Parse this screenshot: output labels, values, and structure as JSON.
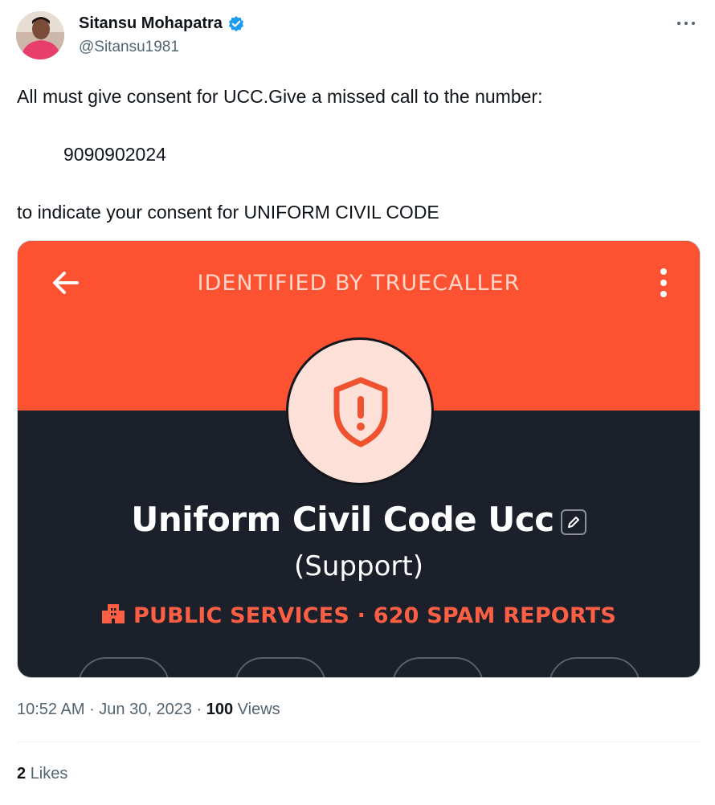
{
  "author": {
    "display_name": "Sitansu Mohapatra",
    "handle": "@Sitansu1981",
    "verified_icon": "verified-badge-icon",
    "verified_color": "#1d9bf0"
  },
  "tweet": {
    "line1": "All must give consent for UCC.Give a missed call to the number:",
    "line2": "9090902024",
    "line3": "to indicate your consent for UNIFORM CIVIL CODE"
  },
  "media": {
    "header_title": "IDENTIFIED BY TRUECALLER",
    "caller_name": "Uniform Civil Code Ucc",
    "caller_subtitle": "(Support)",
    "spam_label": "PUBLIC SERVICES · 620 SPAM REPORTS",
    "colors": {
      "accent": "#fc5231",
      "dark": "#1c202b",
      "spam": "#fc5f44",
      "badge": "#fde0d8"
    }
  },
  "meta": {
    "time": "10:52 AM",
    "date": "Jun 30, 2023",
    "views_count": "100",
    "views_label": "Views",
    "likes_count": "2",
    "likes_label": "Likes"
  }
}
